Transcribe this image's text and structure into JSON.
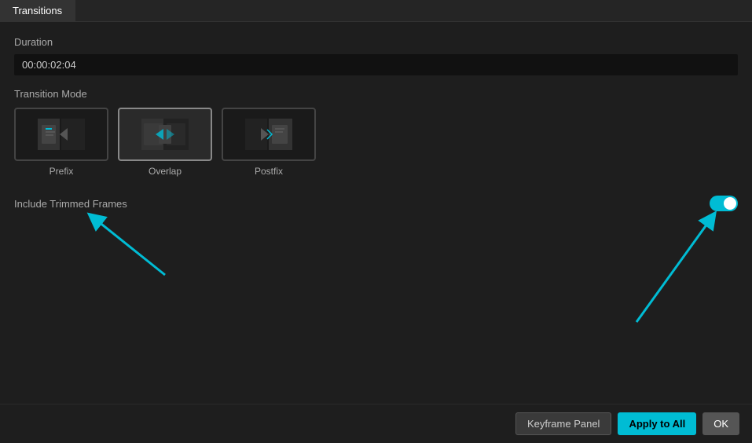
{
  "tabs": [
    {
      "id": "transitions",
      "label": "Transitions",
      "active": true
    }
  ],
  "duration": {
    "label": "Duration",
    "value": "00:00:02:04"
  },
  "transition_mode": {
    "label": "Transition Mode",
    "options": [
      {
        "id": "prefix",
        "name": "Prefix",
        "selected": false
      },
      {
        "id": "overlap",
        "name": "Overlap",
        "selected": true
      },
      {
        "id": "postfix",
        "name": "Postfix",
        "selected": false
      }
    ]
  },
  "include_trimmed_frames": {
    "label": "Include Trimmed Frames",
    "enabled": true
  },
  "buttons": {
    "keyframe_panel": "Keyframe Panel",
    "apply_to_all": "Apply to All",
    "ok": "OK"
  },
  "colors": {
    "accent": "#00bcd4",
    "bg_dark": "#111111",
    "bg_medium": "#1e1e1e",
    "bg_light": "#2d2d2d",
    "border": "#444444",
    "text_muted": "#aaaaaa",
    "text_light": "#cccccc"
  }
}
